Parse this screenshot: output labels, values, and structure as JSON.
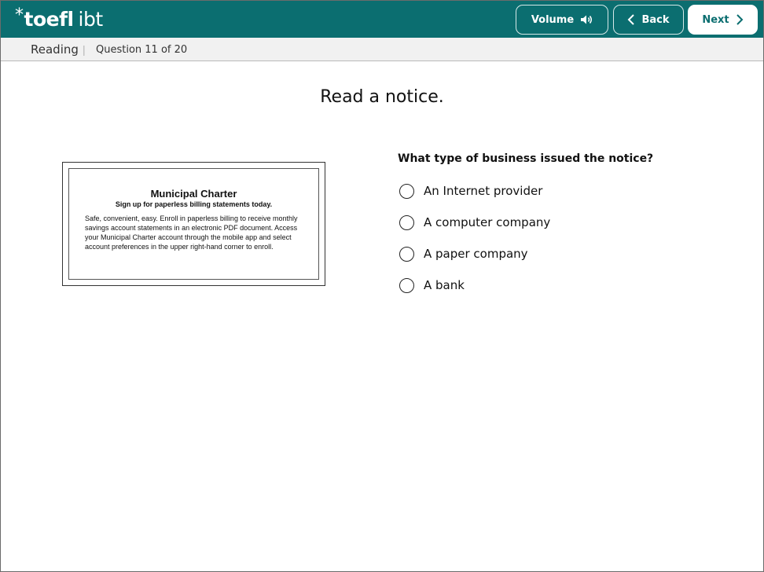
{
  "header": {
    "logo_star": "*",
    "logo_main": "toefl",
    "logo_suffix": "ibt",
    "volume_label": "Volume",
    "back_label": "Back",
    "next_label": "Next"
  },
  "subheader": {
    "section": "Reading",
    "separator": "|",
    "question_count": "Question 11 of 20"
  },
  "main": {
    "instruction": "Read a notice.",
    "notice": {
      "title": "Municipal Charter",
      "subtitle": "Sign up for paperless billing statements today.",
      "body": "Safe, convenient, easy. Enroll in paperless billing to receive monthly savings account statements in an electronic PDF document. Access your Municipal Charter account through the mobile app and select account preferences in the upper right-hand corner to enroll."
    },
    "question": "What type of business issued the notice?",
    "options": [
      {
        "label": "An Internet provider"
      },
      {
        "label": "A computer company"
      },
      {
        "label": "A paper company"
      },
      {
        "label": "A bank"
      }
    ]
  },
  "colors": {
    "header_bg": "#0b6e70",
    "subbar_bg": "#f1f1f1"
  }
}
